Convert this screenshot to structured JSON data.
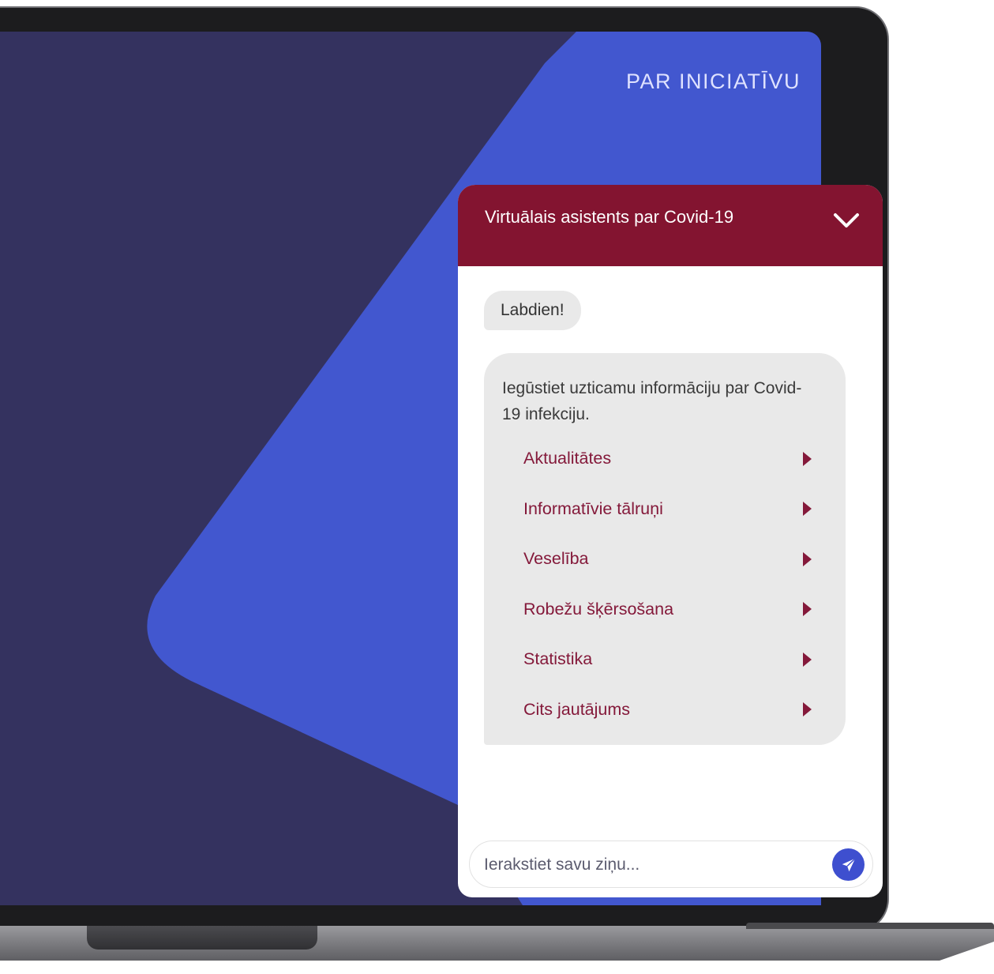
{
  "page": {
    "nav_link": "PAR INICIATĪVU",
    "scroll_icon": "chevron-down-circle-icon"
  },
  "colors": {
    "screen_bg": "#34325f",
    "accent_blue": "#4257cf",
    "chat_header": "#831430",
    "option_text": "#84193a",
    "send_button": "#3e4fcf",
    "bubble_bg": "#e9e9e9"
  },
  "chat": {
    "title": "Virtuālais asistents par Covid-19",
    "collapse_icon": "chevron-down-icon",
    "greeting": "Labdien!",
    "intro": "Iegūstiet uzticamu informāciju par Covid-19 infekciju.",
    "options": [
      {
        "label": "Aktualitātes",
        "icon": "caret-right-icon"
      },
      {
        "label": "Informatīvie tālruņi",
        "icon": "caret-right-icon"
      },
      {
        "label": "Veselība",
        "icon": "caret-right-icon"
      },
      {
        "label": "Robežu šķērsošana",
        "icon": "caret-right-icon"
      },
      {
        "label": "Statistika",
        "icon": "caret-right-icon"
      },
      {
        "label": "Cits jautājums",
        "icon": "caret-right-icon"
      }
    ],
    "input": {
      "value": "",
      "placeholder": "Ierakstiet savu ziņu..."
    },
    "send_icon": "paper-plane-icon"
  }
}
